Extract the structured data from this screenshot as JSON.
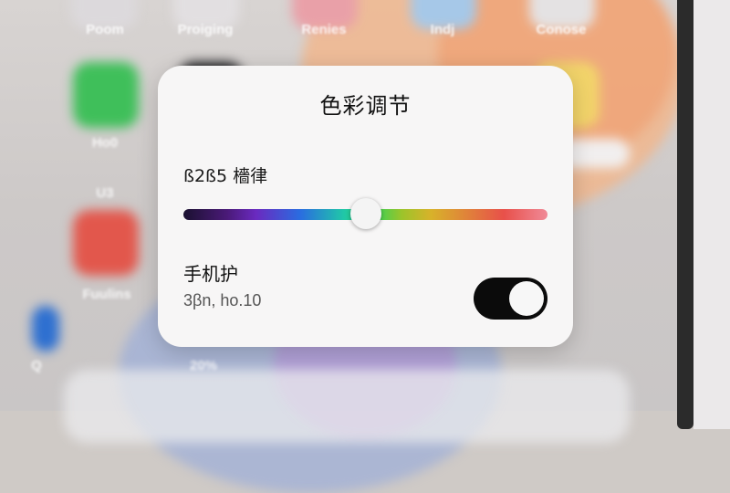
{
  "home_screen": {
    "labels": [
      "Poom",
      "Proiging",
      "Renies",
      "Indj",
      "Conose",
      "Ho0",
      "U3",
      "Fuulins",
      "20%",
      "Q"
    ]
  },
  "dialog": {
    "title": "色彩调节",
    "slider": {
      "label": "ß2ß5 檣律",
      "value_fraction": 0.5
    },
    "toggle": {
      "title": "手机护",
      "subtitle": "3βn, ho.10",
      "state": "on"
    }
  },
  "colors": {
    "dialog_bg": "#f7f6f6",
    "toggle_on": "#0b0b0b"
  }
}
